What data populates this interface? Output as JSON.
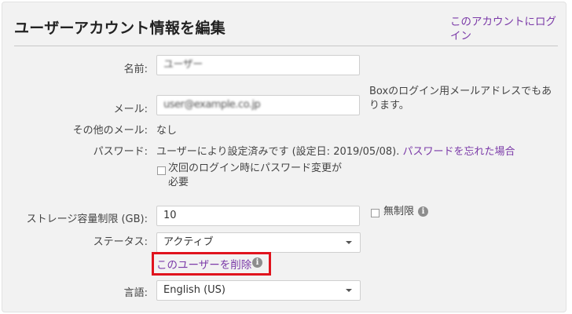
{
  "header": {
    "title": "ユーザーアカウント情報を編集",
    "signin_link": "このアカウントにログイン"
  },
  "form": {
    "name_label": "名前:",
    "name_value": "ユーザー",
    "email_label": "メール:",
    "email_value": "user@example.co.jp",
    "email_hint": "Boxのログイン用メールアドレスでもあります。",
    "other_email_label": "その他のメール:",
    "other_email_value": "なし",
    "password_label": "パスワード:",
    "password_status": "ユーザーにより設定済みです (設定日: 2019/05/08).",
    "password_forgot_link": "パスワードを忘れた場合",
    "require_password_change_label": "次回のログイン時にパスワード変更が必要",
    "require_password_change_checked": false,
    "storage_label": "ストレージ容量制限 (GB):",
    "storage_value": "10",
    "unlimited_label": "無制限",
    "unlimited_checked": false,
    "status_label": "ステータス:",
    "status_value": "アクティブ",
    "delete_user_link": "このユーザーを削除",
    "language_label": "言語:",
    "language_value": "English (US)"
  },
  "icons": {
    "info": "info-icon",
    "dropdown": "chevron-down-icon"
  },
  "colors": {
    "link": "#7b3aa8",
    "highlight_box": "#e0141e",
    "panel_bg": "#f2f2f2"
  }
}
